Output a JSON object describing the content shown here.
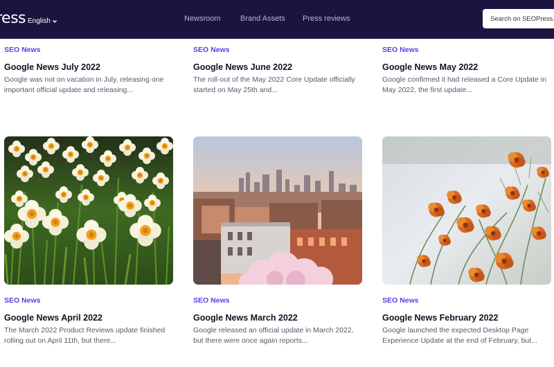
{
  "header": {
    "logo_text": "ress",
    "language": "English",
    "nav": [
      "Newsroom",
      "Brand Assets",
      "Press reviews"
    ],
    "search_placeholder": "Search on SEOPress.org"
  },
  "posts_top": [
    {
      "category": "SEO News",
      "title": "Google News July 2022",
      "excerpt": "Google was not on vacation in July, releasing one important official update and releasing..."
    },
    {
      "category": "SEO News",
      "title": "Google News June 2022",
      "excerpt": "The roll-out of the May 2022 Core Update officially started on May 25th and..."
    },
    {
      "category": "SEO News",
      "title": "Google News May 2022",
      "excerpt": "Google confirmed it had released a Core Update in May 2022, the first update..."
    }
  ],
  "posts_bottom": [
    {
      "category": "SEO News",
      "title": "Google News April 2022",
      "excerpt": "The March 2022 Product Reviews update finished rolling out on April 11th, but there...",
      "image": "daffodils-photo"
    },
    {
      "category": "SEO News",
      "title": "Google News March 2022",
      "excerpt": "Google released an official update in March 2022, but there were once again reports...",
      "image": "city-skyline-photo"
    },
    {
      "category": "SEO News",
      "title": "Google News February 2022",
      "excerpt": "Google launched the expected Desktop Page Experience Update at the end of February, but...",
      "image": "orange-flowers-photo"
    }
  ],
  "colors": {
    "header_bg": "#1a1540",
    "category": "#5b3ce8",
    "title": "#111122",
    "excerpt": "#55596a"
  }
}
